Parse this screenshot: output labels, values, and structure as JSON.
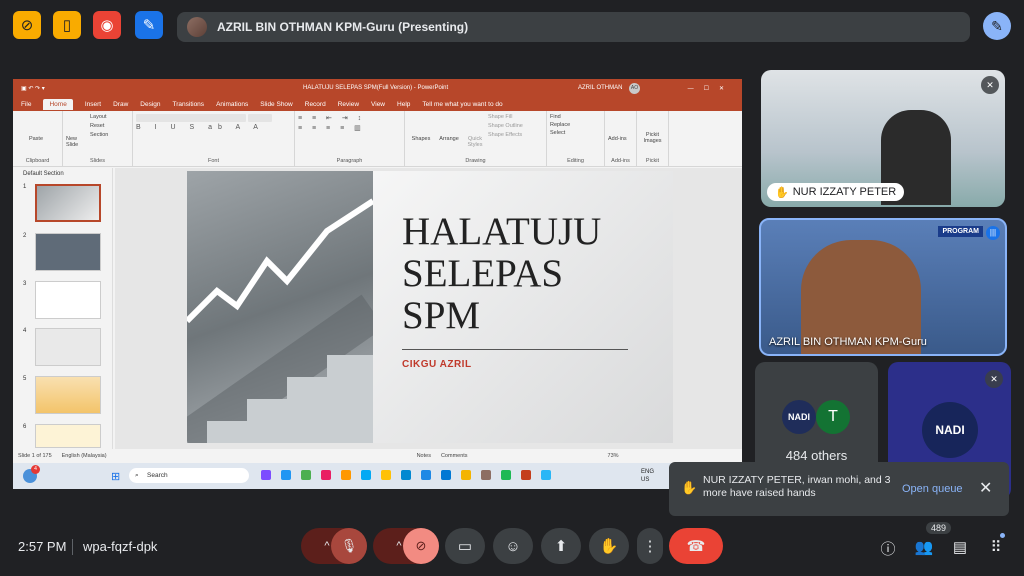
{
  "top_bar": {
    "icons": [
      "no-video-icon",
      "door-icon",
      "record-icon",
      "edit-doc-icon"
    ],
    "presenter_label": "AZRIL BIN OTHMAN KPM-Guru (Presenting)",
    "colors": {
      "icon_yellow": "#f9ab00",
      "icon_red": "#ea4335",
      "icon_blue": "#1a73e8",
      "pen_blue": "#8ab4f8"
    }
  },
  "powerpoint": {
    "window_title": "HALATUJU SELEPAS SPM(Full Version) - PowerPoint",
    "user": "AZRIL OTHMAN",
    "user_initials": "AO",
    "tabs": [
      "File",
      "Home",
      "Insert",
      "Draw",
      "Design",
      "Transitions",
      "Animations",
      "Slide Show",
      "Record",
      "Review",
      "View",
      "Help"
    ],
    "tell_me": "Tell me what you want to do",
    "ribbon_groups": [
      "Clipboard",
      "Slides",
      "Font",
      "Paragraph",
      "Drawing",
      "Editing",
      "Add-ins",
      "Pickit"
    ],
    "ribbon_labels": {
      "paste": "Paste",
      "new_slide": "New Slide",
      "layout": "Layout",
      "reset": "Reset",
      "section": "Section",
      "shapes": "Shapes",
      "arrange": "Arrange",
      "quick_styles": "Quick Styles",
      "shape_fill": "Shape Fill",
      "shape_outline": "Shape Outline",
      "shape_effects": "Shape Effects",
      "find": "Find",
      "replace": "Replace",
      "select": "Select",
      "add_ins": "Add-ins",
      "pickit": "Pickit Images"
    },
    "section_name": "Default Section",
    "thumbnails": [
      "1",
      "2",
      "3",
      "4",
      "5",
      "6"
    ],
    "slide": {
      "title": "HALATUJU\nSELEPAS\nSPM",
      "subtitle": "CIKGU AZRIL"
    },
    "status": {
      "slide_count": "Slide 1 of 175",
      "language": "English (Malaysia)",
      "notes": "Notes",
      "comments": "Comments",
      "zoom": "73%"
    },
    "taskbar": {
      "search_placeholder": "Search",
      "lang": "ENG",
      "region": "US",
      "badge": "4"
    }
  },
  "participants": {
    "tile1_name": "NUR IZZATY PETER",
    "tile2_name": "AZRIL BIN OTHMAN KPM-Guru",
    "tile2_banner": "PROGRAM",
    "others_initial": "T",
    "others_logo": "NADI",
    "others_count": "484 others",
    "tile4_logo": "NADI"
  },
  "notification": {
    "text": "NUR IZZATY PETER, irwan mohi, and 3 more have raised hands",
    "action": "Open queue"
  },
  "bottom_bar": {
    "time": "2:57 PM",
    "meeting_code": "wpa-fqzf-dpk",
    "people_count": "489"
  }
}
